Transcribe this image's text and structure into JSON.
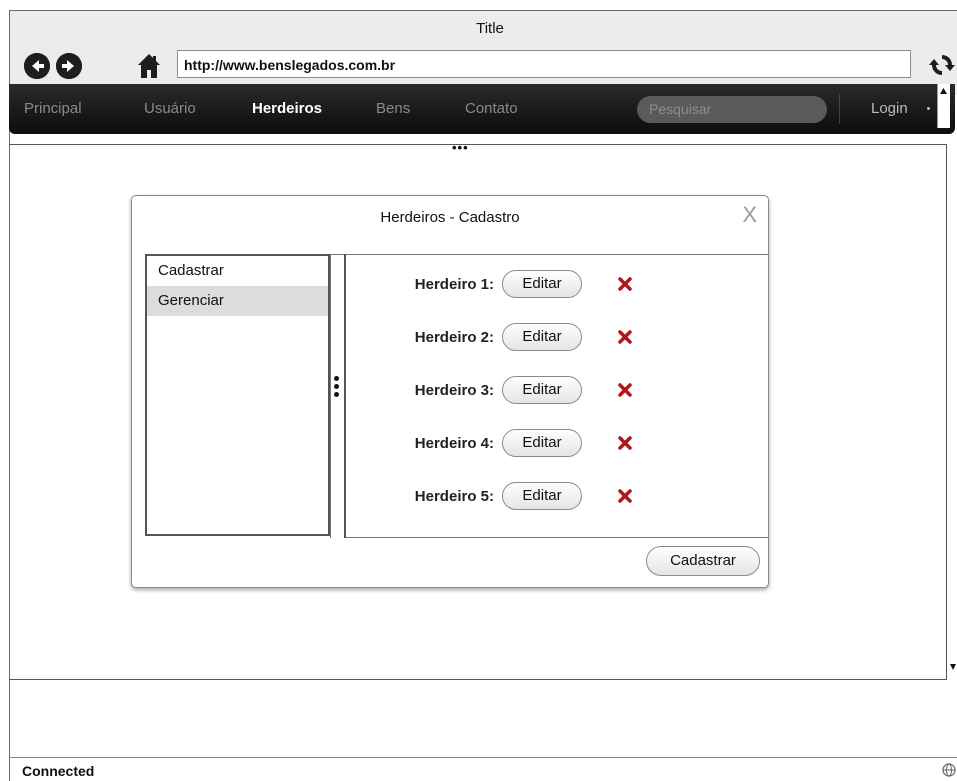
{
  "window": {
    "title": "Title"
  },
  "toolbar": {
    "back_icon": "back-arrow-icon",
    "forward_icon": "forward-arrow-icon",
    "home_icon": "home-icon",
    "url": "http://www.benslegados.com.br",
    "refresh_icon": "refresh-icon"
  },
  "navbar": {
    "items": [
      {
        "label": "Principal",
        "active": false
      },
      {
        "label": "Usuário",
        "active": false
      },
      {
        "label": "Herdeiros",
        "active": true
      },
      {
        "label": "Bens",
        "active": false
      },
      {
        "label": "Contato",
        "active": false
      }
    ],
    "search_placeholder": "Pesquisar",
    "login_label": "Login"
  },
  "modal": {
    "title": "Herdeiros - Cadastro",
    "close_glyph": "X",
    "sidebar": [
      {
        "label": "Cadastrar",
        "selected": false
      },
      {
        "label": "Gerenciar",
        "selected": true
      }
    ],
    "heirs": [
      {
        "label": "Herdeiro 1:",
        "edit": "Editar"
      },
      {
        "label": "Herdeiro 2:",
        "edit": "Editar"
      },
      {
        "label": "Herdeiro 3:",
        "edit": "Editar"
      },
      {
        "label": "Herdeiro 4:",
        "edit": "Editar"
      },
      {
        "label": "Herdeiro 5:",
        "edit": "Editar"
      }
    ],
    "primary_button": "Cadastrar"
  },
  "status": {
    "text": "Connected"
  },
  "colors": {
    "navbar": "#111111",
    "delete": "#b0161b",
    "selected_row": "#dcdcdc"
  }
}
